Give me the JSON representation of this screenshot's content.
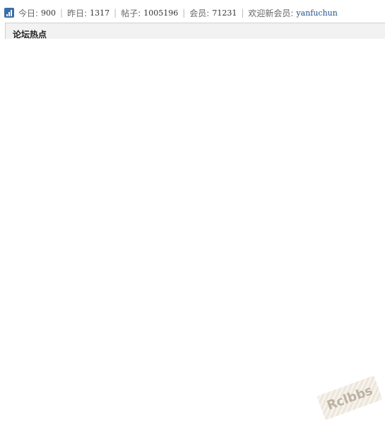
{
  "stats": {
    "today_label": "今日:",
    "today_value": "900",
    "yesterday_label": "昨日:",
    "yesterday_value": "1317",
    "posts_label": "帖子:",
    "posts_value": "1005196",
    "members_label": "会员:",
    "members_value": "71231",
    "new_member_label": "欢迎新会员:",
    "new_member_name": "yanfuchun",
    "separator": "|",
    "icon": "bar-chart-icon"
  },
  "hot_panel": {
    "title": "论坛热点"
  },
  "watermark": {
    "text": "Rclbbs"
  },
  "colors": {
    "icon_bg": "#3a6ea5",
    "link": "#1e4f8a",
    "panel_bg": "#f2f2f2"
  }
}
